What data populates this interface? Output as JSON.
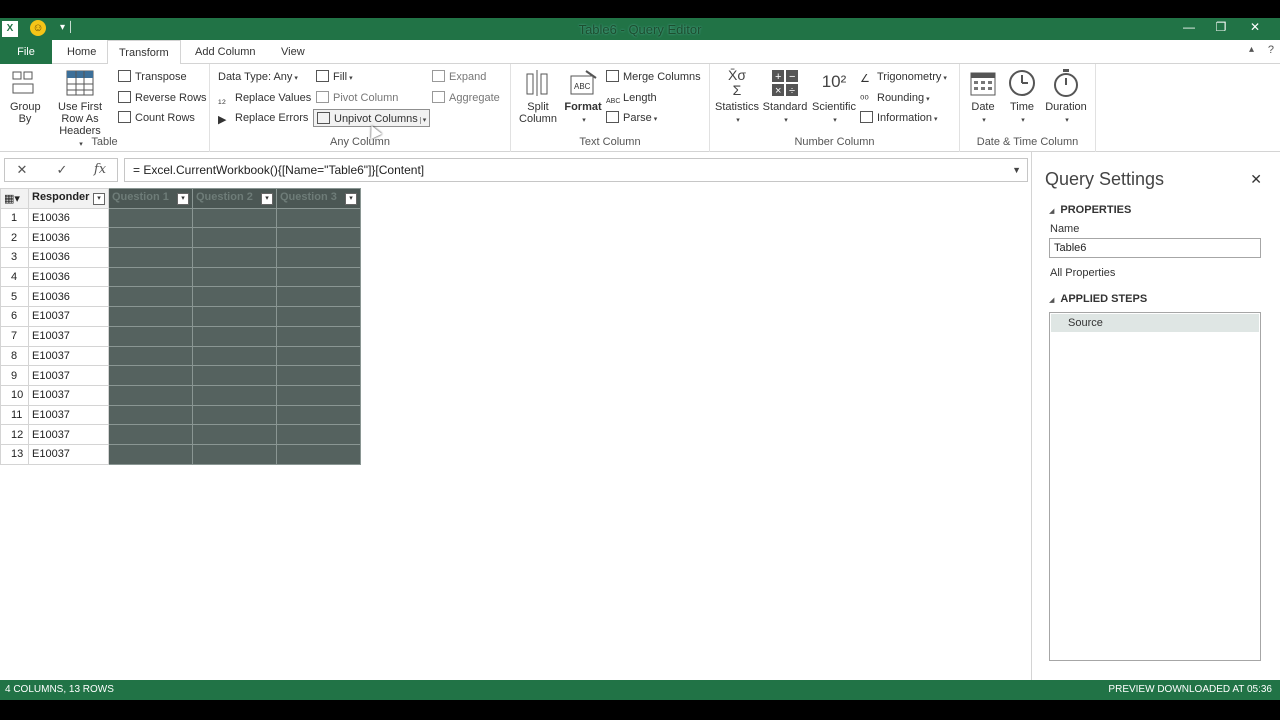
{
  "window": {
    "title": "Table6 - Query Editor",
    "app_icon": "X",
    "controls": [
      "—",
      "❐",
      "✕"
    ]
  },
  "tabs": [
    {
      "label": "File"
    },
    {
      "label": "Home"
    },
    {
      "label": "Transform"
    },
    {
      "label": "Add Column"
    },
    {
      "label": "View"
    }
  ],
  "ribbon": {
    "table": {
      "label": "Table",
      "group_by": "Group By",
      "use_first_row": "Use First Row As Headers",
      "transpose": "Transpose",
      "reverse_rows": "Reverse Rows",
      "count_rows": "Count Rows"
    },
    "any_column": {
      "label": "Any Column",
      "data_type": "Data Type: Any",
      "replace_values": "Replace Values",
      "replace_errors": "Replace Errors",
      "fill": "Fill",
      "pivot_column": "Pivot Column",
      "unpivot_columns": "Unpivot Columns",
      "expand": "Expand",
      "aggregate": "Aggregate"
    },
    "text_column": {
      "label": "Text Column",
      "split_column": "Split Column",
      "format": "Format",
      "merge_columns": "Merge Columns",
      "length": "Length",
      "parse": "Parse"
    },
    "number_column": {
      "label": "Number Column",
      "statistics": "Statistics",
      "standard": "Standard",
      "scientific": "Scientific",
      "trigonometry": "Trigonometry",
      "rounding": "Rounding",
      "information": "Information"
    },
    "datetime_column": {
      "label": "Date & Time Column",
      "date": "Date",
      "time": "Time",
      "duration": "Duration"
    }
  },
  "formula": {
    "cancel": "✕",
    "confirm": "✓",
    "fx": "fx",
    "text": "= Excel.CurrentWorkbook(){[Name=\"Table6\"]}[Content]"
  },
  "grid": {
    "columns": [
      "Responder",
      "Question 1",
      "Question 2",
      "Question 3"
    ],
    "rows": [
      {
        "n": "1",
        "responder": "E10036"
      },
      {
        "n": "2",
        "responder": "E10036"
      },
      {
        "n": "3",
        "responder": "E10036"
      },
      {
        "n": "4",
        "responder": "E10036"
      },
      {
        "n": "5",
        "responder": "E10036"
      },
      {
        "n": "6",
        "responder": "E10037"
      },
      {
        "n": "7",
        "responder": "E10037"
      },
      {
        "n": "8",
        "responder": "E10037"
      },
      {
        "n": "9",
        "responder": "E10037"
      },
      {
        "n": "10",
        "responder": "E10037"
      },
      {
        "n": "11",
        "responder": "E10037"
      },
      {
        "n": "12",
        "responder": "E10037"
      },
      {
        "n": "13",
        "responder": "E10037"
      }
    ]
  },
  "query_settings": {
    "title": "Query Settings",
    "properties": "PROPERTIES",
    "name_label": "Name",
    "name_value": "Table6",
    "all_properties": "All Properties",
    "applied_steps": "APPLIED STEPS",
    "steps": [
      "Source"
    ]
  },
  "status": {
    "left": "4 COLUMNS, 13 ROWS",
    "right": "PREVIEW DOWNLOADED AT 05:36"
  },
  "colors": {
    "accent": "#217346"
  }
}
